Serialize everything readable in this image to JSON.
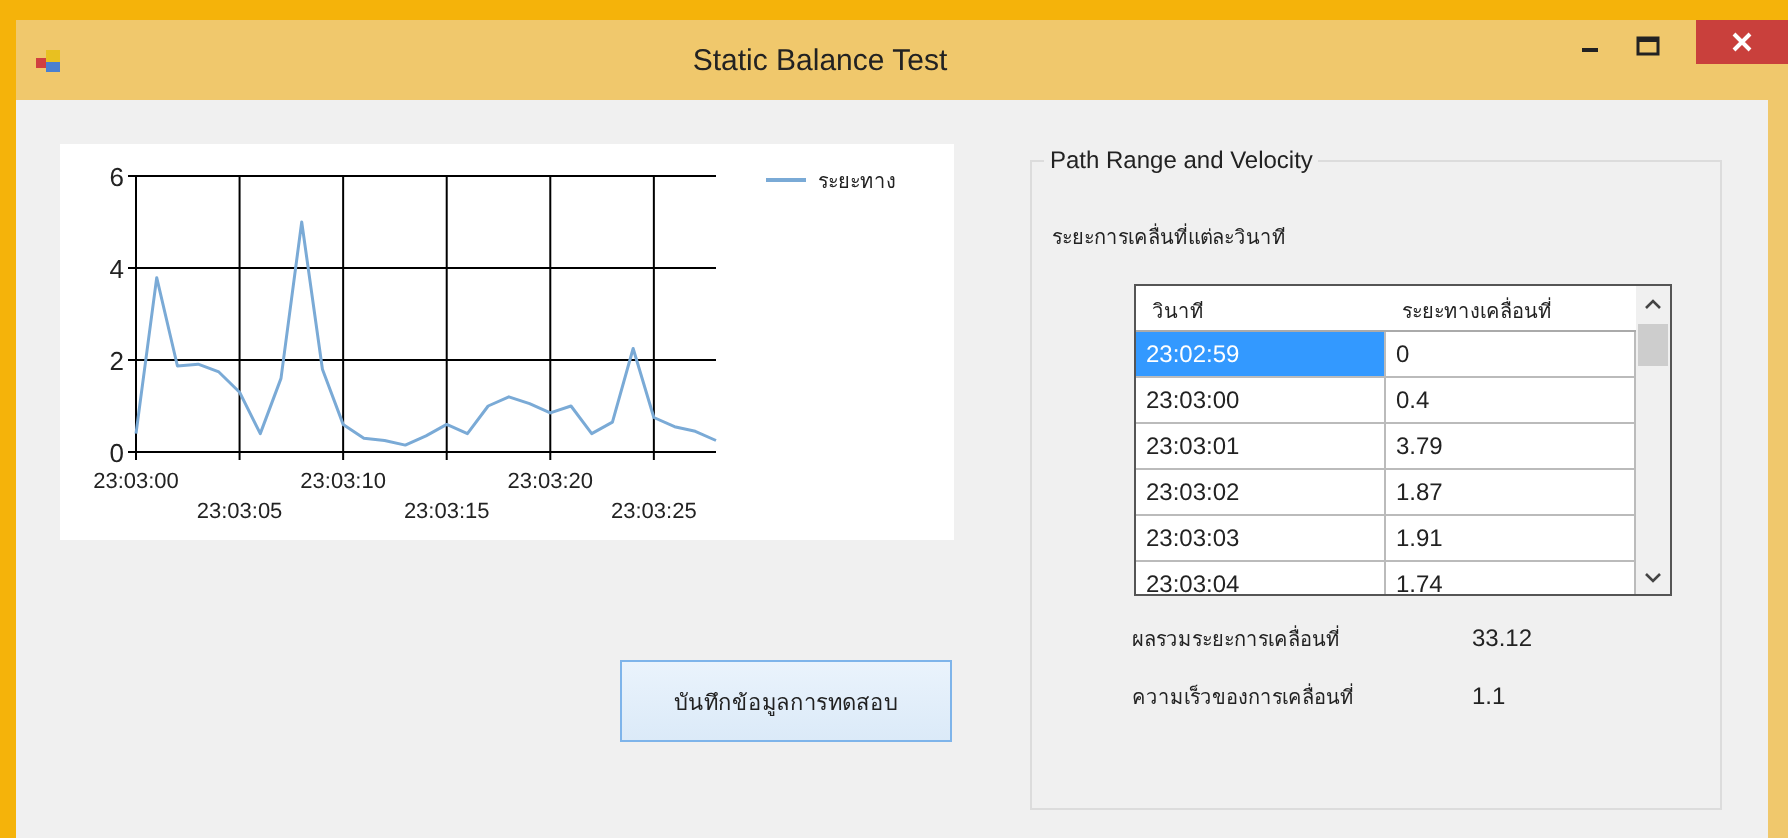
{
  "window": {
    "title": "Static Balance Test"
  },
  "chart": {
    "chart_data": {
      "type": "line",
      "categories": [
        "23:03:00",
        null,
        null,
        null,
        null,
        "23:03:05",
        null,
        null,
        null,
        null,
        "23:03:10",
        null,
        null,
        null,
        null,
        "23:03:15",
        null,
        null,
        null,
        null,
        "23:03:20",
        null,
        null,
        null,
        null,
        "23:03:25",
        null,
        null,
        null
      ],
      "ylim": [
        0,
        6
      ],
      "grid": true,
      "yticks": [
        0,
        2,
        4,
        6
      ],
      "series": [
        {
          "name": "ระยะทาง",
          "color": "#7aaad6",
          "values": [
            0.4,
            3.79,
            1.87,
            1.91,
            1.74,
            1.3,
            0.4,
            1.6,
            5.0,
            1.8,
            0.6,
            0.3,
            0.25,
            0.15,
            0.35,
            0.6,
            0.4,
            1.0,
            1.2,
            1.05,
            0.85,
            1.0,
            0.4,
            0.65,
            2.25,
            0.75,
            0.55,
            0.45,
            0.25
          ]
        }
      ]
    }
  },
  "save_button": {
    "label": "บันทึกข้อมูลการทดสอบ"
  },
  "group": {
    "title": "Path Range and Velocity",
    "subtitle": "ระยะการเคลื่นที่แต่ละวินาที",
    "table": {
      "columns": [
        "วินาที",
        "ระยะทางเคลื่อนที่"
      ],
      "rows": [
        {
          "cells": [
            "23:02:59",
            "0"
          ],
          "selected": true
        },
        {
          "cells": [
            "23:03:00",
            "0.4"
          ],
          "selected": false
        },
        {
          "cells": [
            "23:03:01",
            "3.79"
          ],
          "selected": false
        },
        {
          "cells": [
            "23:03:02",
            "1.87"
          ],
          "selected": false
        },
        {
          "cells": [
            "23:03:03",
            "1.91"
          ],
          "selected": false
        },
        {
          "cells": [
            "23:03:04",
            "1.74"
          ],
          "selected": false
        }
      ]
    },
    "results": [
      {
        "label": "ผลรวมระยะการเคลื่อนที่",
        "value": "33.12"
      },
      {
        "label": "ความเร็วของการเคลื่อนที่",
        "value": "1.1"
      }
    ]
  }
}
